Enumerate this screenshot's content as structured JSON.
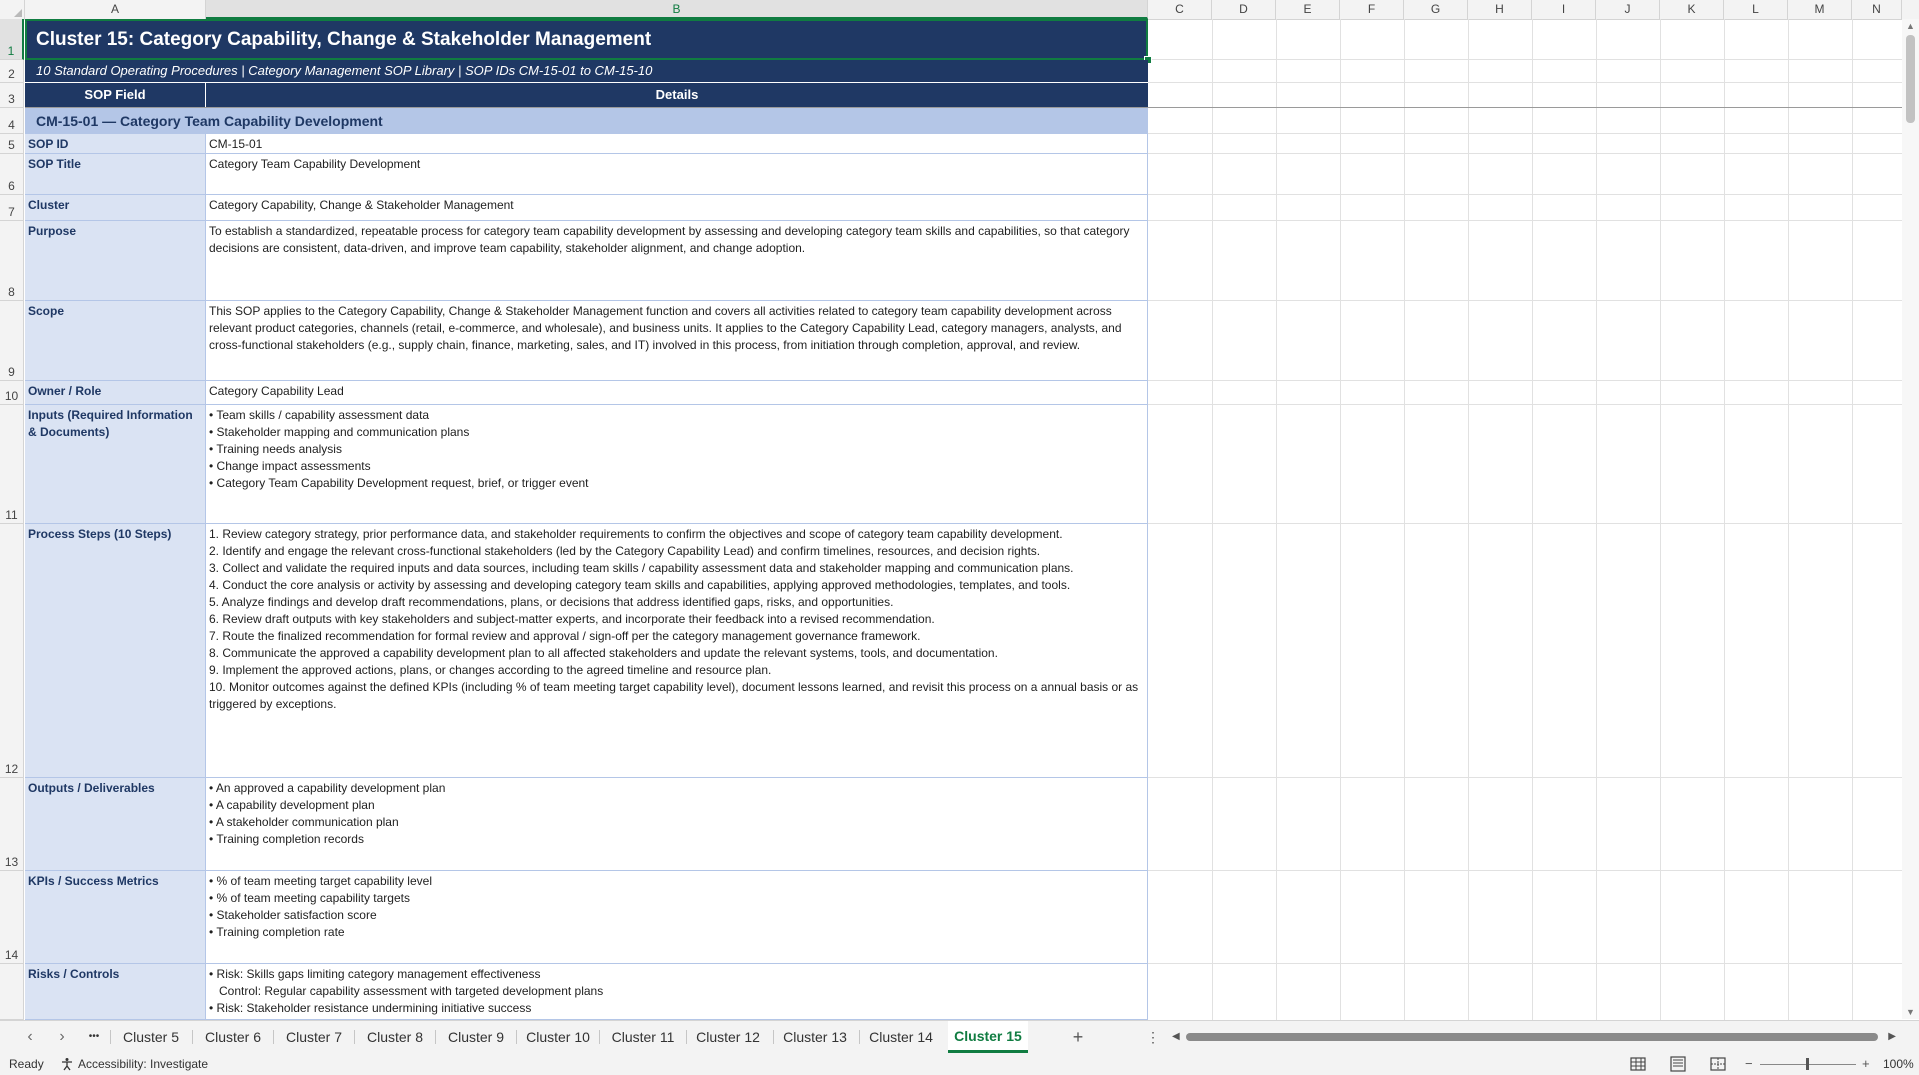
{
  "columns": [
    "A",
    "B",
    "C",
    "D",
    "E",
    "F",
    "G",
    "H",
    "I",
    "J",
    "K",
    "L",
    "M",
    "N"
  ],
  "rows": [
    "1",
    "2",
    "3",
    "4",
    "5",
    "6",
    "7",
    "8",
    "9",
    "10",
    "11",
    "12",
    "13",
    "14"
  ],
  "sheet": {
    "title": "Cluster 15: Category Capability, Change & Stakeholder Management",
    "subtitle": "10 Standard Operating Procedures | Category Management SOP Library | SOP IDs CM-15-01 to CM-15-10",
    "header_field": "SOP Field",
    "header_details": "Details",
    "section": "CM-15-01  —  Category Team Capability Development"
  },
  "fields": [
    {
      "label": "SOP ID",
      "value": "CM-15-01"
    },
    {
      "label": "SOP Title",
      "value": "Category Team Capability Development"
    },
    {
      "label": "Cluster",
      "value": "Category Capability, Change & Stakeholder Management"
    },
    {
      "label": "Purpose",
      "value": "To establish a standardized, repeatable process for category team capability development by assessing and developing category team skills and capabilities, so that category decisions are consistent, data-driven, and improve team capability, stakeholder alignment, and change adoption."
    },
    {
      "label": "Scope",
      "value": "This SOP applies to the Category Capability, Change & Stakeholder Management function and covers all activities related to category team capability development across relevant product categories, channels (retail, e-commerce, and wholesale), and business units. It applies to the Category Capability Lead, category managers, analysts, and cross-functional stakeholders (e.g., supply chain, finance, marketing, sales, and IT) involved in this process, from initiation through completion, approval, and review."
    },
    {
      "label": "Owner / Role",
      "value": "Category Capability Lead"
    },
    {
      "label": "Inputs (Required Information & Documents)",
      "value": "• Team skills / capability assessment data\n• Stakeholder mapping and communication plans\n• Training needs analysis\n• Change impact assessments\n• Category Team Capability Development request, brief, or trigger event"
    },
    {
      "label": "Process Steps (10 Steps)",
      "value": "1. Review category strategy, prior performance data, and stakeholder requirements to confirm the objectives and scope of category team capability development.\n2. Identify and engage the relevant cross-functional stakeholders (led by the Category Capability Lead) and confirm timelines, resources, and decision rights.\n3. Collect and validate the required inputs and data sources, including team skills / capability assessment data and stakeholder mapping and communication plans.\n4. Conduct the core analysis or activity by assessing and developing category team skills and capabilities, applying approved methodologies, templates, and tools.\n5. Analyze findings and develop draft recommendations, plans, or decisions that address identified gaps, risks, and opportunities.\n6. Review draft outputs with key stakeholders and subject-matter experts, and incorporate their feedback into a revised recommendation.\n7. Route the finalized recommendation for formal review and approval / sign-off per the category management governance framework.\n8. Communicate the approved a capability development plan to all affected stakeholders and update the relevant systems, tools, and documentation.\n9. Implement the approved actions, plans, or changes according to the agreed timeline and resource plan.\n10. Monitor outcomes against the defined KPIs (including % of team meeting target capability level), document lessons learned, and revisit this process on a annual basis or as triggered by exceptions."
    },
    {
      "label": "Outputs / Deliverables",
      "value": "• An approved a capability development plan\n• A capability development plan\n• A stakeholder communication plan\n• Training completion records"
    },
    {
      "label": "KPIs / Success Metrics",
      "value": "• % of team meeting target capability level\n• % of team meeting capability targets\n• Stakeholder satisfaction score\n• Training completion rate"
    },
    {
      "label": "Risks / Controls",
      "value": "• Risk: Skills gaps limiting category management effectiveness\n   Control: Regular capability assessment with targeted development plans\n• Risk: Stakeholder resistance undermining initiative success\n   Control: Early stakeholder engagement and structured change management"
    }
  ],
  "tabs": {
    "more": "•••",
    "items": [
      "Cluster 5",
      "Cluster 6",
      "Cluster 7",
      "Cluster 8",
      "Cluster 9",
      "Cluster 10",
      "Cluster 11",
      "Cluster 12",
      "Cluster 13",
      "Cluster 14"
    ],
    "active": "Cluster 15",
    "add": "+"
  },
  "status": {
    "ready": "Ready",
    "accessibility": "Accessibility: Investigate",
    "zoom": "100%"
  },
  "colors": {
    "header_navy": "#1f3864",
    "label_fill": "#dae3f3",
    "section_fill": "#b4c6e7",
    "excel_green": "#107c41"
  }
}
